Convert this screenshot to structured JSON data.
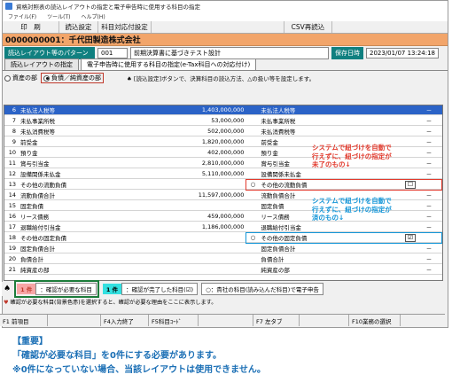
{
  "window": {
    "title": "資格対照表の読込レイアウトの指定と電子申告時に使用する科目の指定",
    "menu": [
      "ファイル(F)",
      "ツール(T)",
      "ヘルプ(H)"
    ]
  },
  "toolbar": [
    "印　刷",
    "読込設定",
    "科目対応付設定",
    "CSV再読込"
  ],
  "company": "0000000001：千代田製造株式会社",
  "layout_bar": {
    "label": "読込レイアウト等のパターン",
    "code": "001",
    "name": "前期決算書に基づきテスト設計",
    "save_label": "保存日時",
    "save_date": "2023/01/07 13:24:18"
  },
  "tabs": [
    "読込レイアウトの指定",
    "電子申告時に使用する科目の指定(e-Tax科目への対応付け)"
  ],
  "radios": [
    {
      "label": "資産の部",
      "checked": false
    },
    {
      "label": "負債／純資産の部",
      "checked": true
    }
  ],
  "top_note": "[読込設定]ボタンで、決算科目の読込方法、△の扱い等を設定します。",
  "rows": [
    {
      "no": "6",
      "name": "未払法人税等",
      "amount": "1,403,000,000",
      "mark": "",
      "map": "未払法人税等",
      "box": "",
      "dash": "－",
      "selected": true
    },
    {
      "no": "7",
      "name": "未払事業所税",
      "amount": "53,000,000",
      "mark": "",
      "map": "未払事業所税",
      "box": "",
      "dash": "－"
    },
    {
      "no": "8",
      "name": "未払消費税等",
      "amount": "502,000,000",
      "mark": "",
      "map": "未払消費税等",
      "box": "",
      "dash": "－"
    },
    {
      "no": "9",
      "name": "前受金",
      "amount": "1,820,000,000",
      "mark": "",
      "map": "前受金",
      "box": "",
      "dash": "－"
    },
    {
      "no": "10",
      "name": "預り金",
      "amount": "402,000,000",
      "mark": "",
      "map": "預り金",
      "box": "",
      "dash": "－"
    },
    {
      "no": "11",
      "name": "賞与引当金",
      "amount": "2,810,000,000",
      "mark": "",
      "map": "賞与引当金",
      "box": "",
      "dash": "－"
    },
    {
      "no": "12",
      "name": "設備関係未払金",
      "amount": "5,110,000,000",
      "mark": "",
      "map": "設備関係未払金",
      "box": "",
      "dash": "－"
    },
    {
      "no": "13",
      "name": "その他の流動負債",
      "amount": "",
      "mark": "○",
      "map": "その他の流動負債",
      "box": "☐",
      "dash": "",
      "red": true
    },
    {
      "no": "14",
      "name": "流動負債合計",
      "amount": "11,597,000,000",
      "mark": "",
      "map": "流動負債合計",
      "box": "",
      "dash": "－"
    },
    {
      "no": "15",
      "name": "固定負債",
      "amount": "",
      "mark": "",
      "map": "固定負債",
      "box": "",
      "dash": "－"
    },
    {
      "no": "16",
      "name": "リース債務",
      "amount": "459,000,000",
      "mark": "",
      "map": "リース債務",
      "box": "",
      "dash": "－"
    },
    {
      "no": "17",
      "name": "退職給付引当金",
      "amount": "1,186,000,000",
      "mark": "",
      "map": "退職給付引当金",
      "box": "",
      "dash": "－"
    },
    {
      "no": "18",
      "name": "その他の固定負債",
      "amount": "",
      "mark": "○",
      "map": "その他の固定負債",
      "box": "☑",
      "dash": "",
      "blue": true
    },
    {
      "no": "19",
      "name": "固定負債合計",
      "amount": "",
      "mark": "",
      "map": "固定負債合計",
      "box": "",
      "dash": "－"
    },
    {
      "no": "20",
      "name": "負債合計",
      "amount": "",
      "mark": "",
      "map": "負債合計",
      "box": "",
      "dash": "－"
    },
    {
      "no": "21",
      "name": "純資産の部",
      "amount": "",
      "mark": "",
      "map": "純資産の部",
      "box": "",
      "dash": "－"
    }
  ],
  "annotations": {
    "red": [
      "システムで紐づけを自動で",
      "行えずに、紐づけの指定が",
      "未了のもの↓"
    ],
    "blue": [
      "システムで紐づけを自動で",
      "行えずに、紐づけの指定が",
      "済のもの↓"
    ]
  },
  "legend": {
    "needs_count": "1 件",
    "needs_label": "：確認が必要な科目",
    "done_count": "1 件",
    "done_label": "：確認が完了した科目(☑)",
    "circle_label": "○：貴社の科目(読み込んだ科目)で電子申告"
  },
  "bottom_note": "確認が必要な科目(背景色赤)を選択すると、確認が必要な理由をここに表示します。",
  "fkeys": [
    "F1 前項目",
    "",
    "F4入力終了",
    "F5科目ｺｰﾄﾞ",
    "",
    "F7 左タブ",
    "",
    "F10業務の選択"
  ],
  "caption": [
    "【重要】",
    "「確認が必要な科目」を0件にする必要があります。",
    "※0件になっていない場合、当該レイアウトは使用できません。"
  ],
  "colors": {
    "company_bar": "#f2a56a",
    "selected_row": "#2b63c7",
    "needs_confirm": "#f7a6a6",
    "done_confirm": "#33e0e0",
    "caption": "#1b6fb5"
  }
}
